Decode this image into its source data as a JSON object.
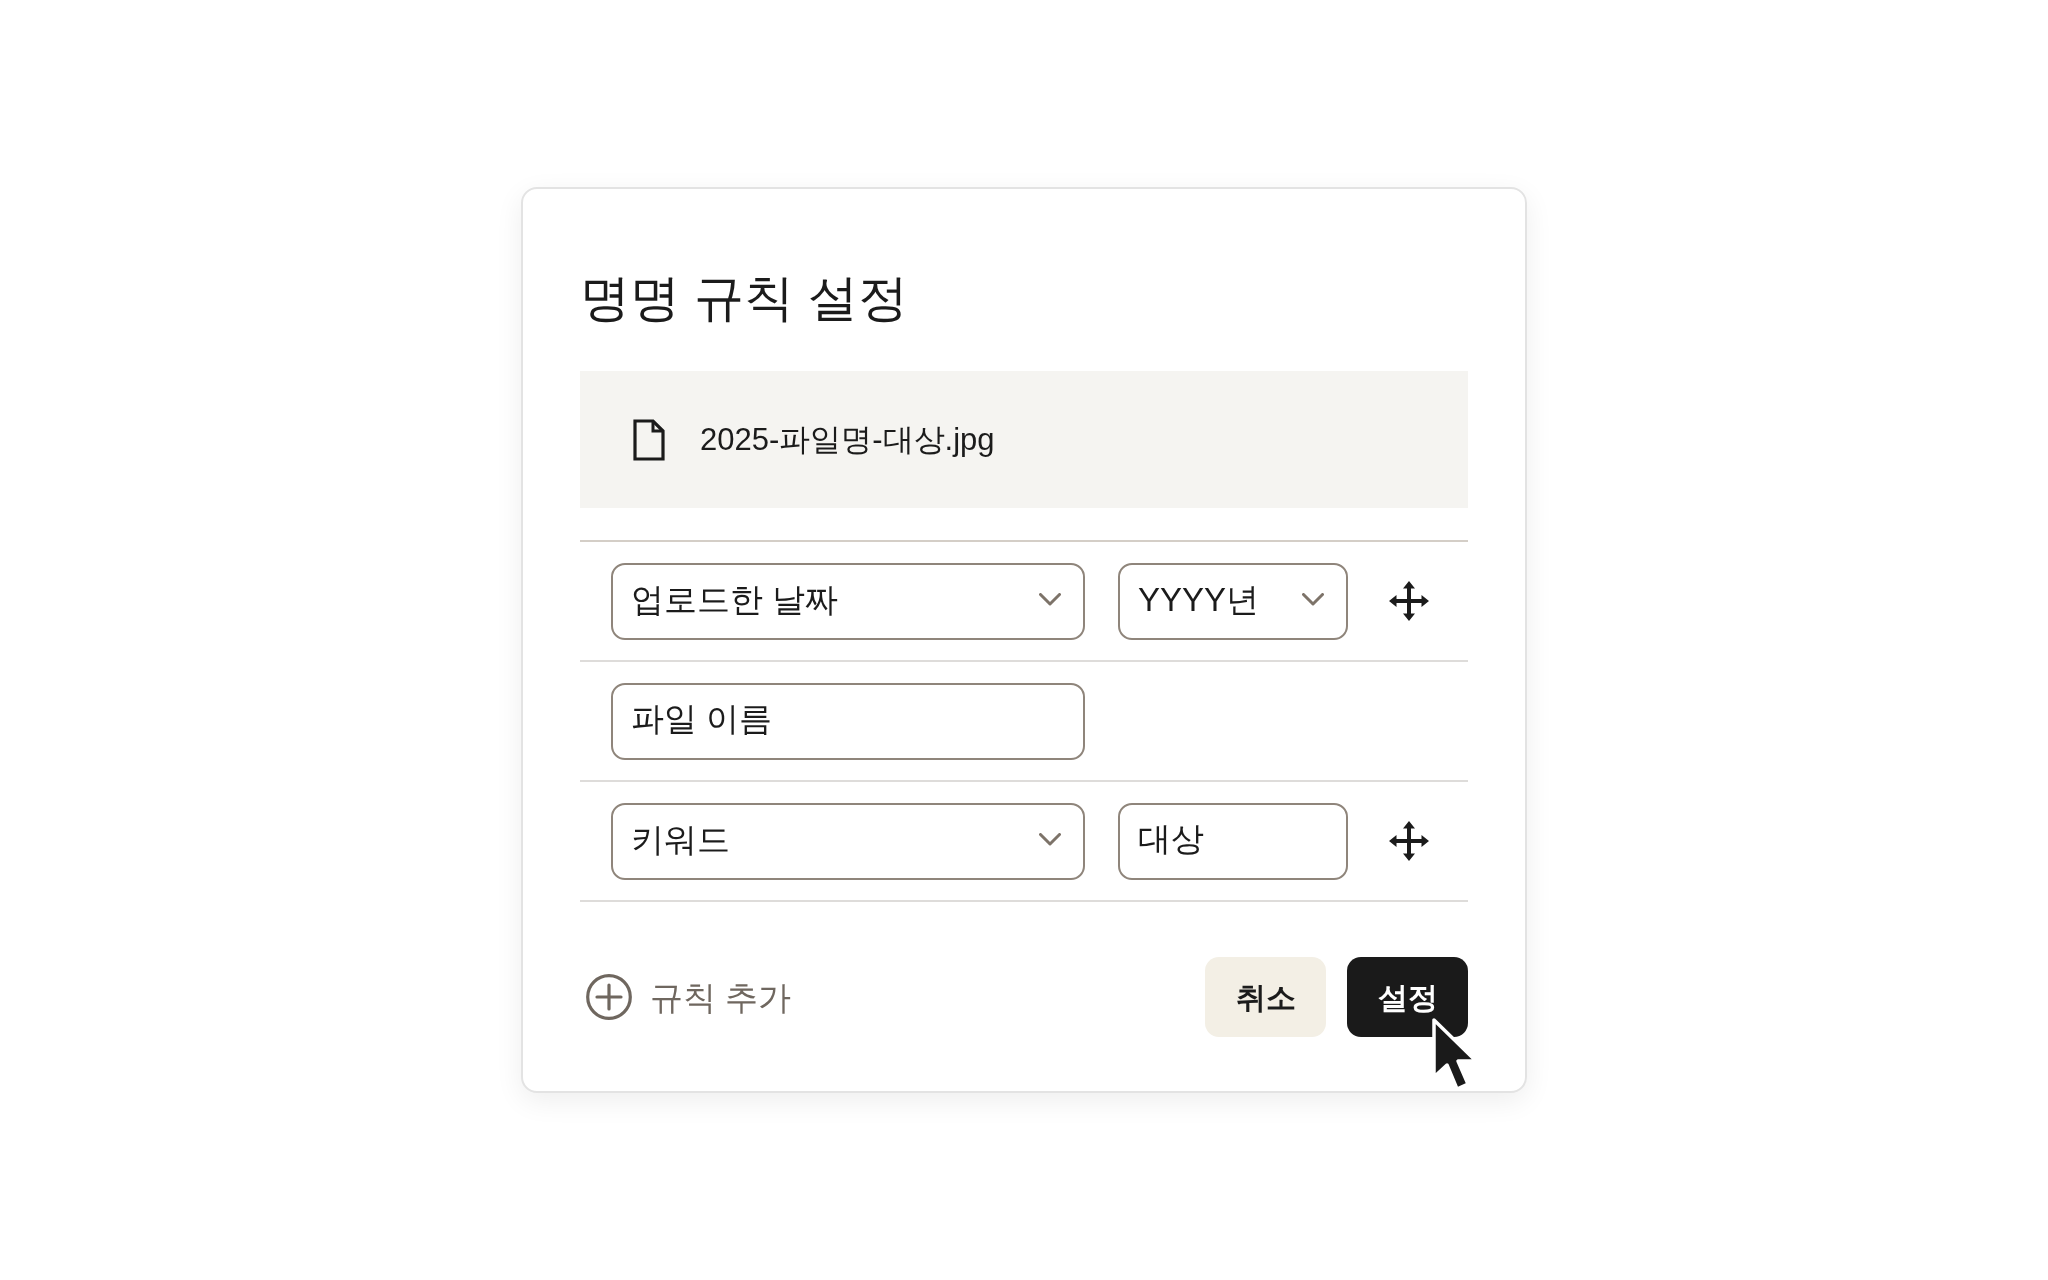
{
  "dialog": {
    "title": "명명 규칙 설정",
    "preview": {
      "filename": "2025-파일명-대상.jpg"
    },
    "rules": [
      {
        "fields": [
          {
            "kind": "select",
            "value": "업로드한 날짜"
          },
          {
            "kind": "select",
            "value": "YYYY년"
          }
        ],
        "movable": true
      },
      {
        "fields": [
          {
            "kind": "input",
            "value": "파일 이름"
          }
        ],
        "movable": false
      },
      {
        "fields": [
          {
            "kind": "select",
            "value": "키워드"
          },
          {
            "kind": "input",
            "value": "대상"
          }
        ],
        "movable": true
      }
    ],
    "add_rule": {
      "label": "규칙 추가"
    },
    "buttons": [
      {
        "kind": "cancel",
        "label": "취소"
      },
      {
        "kind": "confirm",
        "label": "설정"
      }
    ]
  }
}
